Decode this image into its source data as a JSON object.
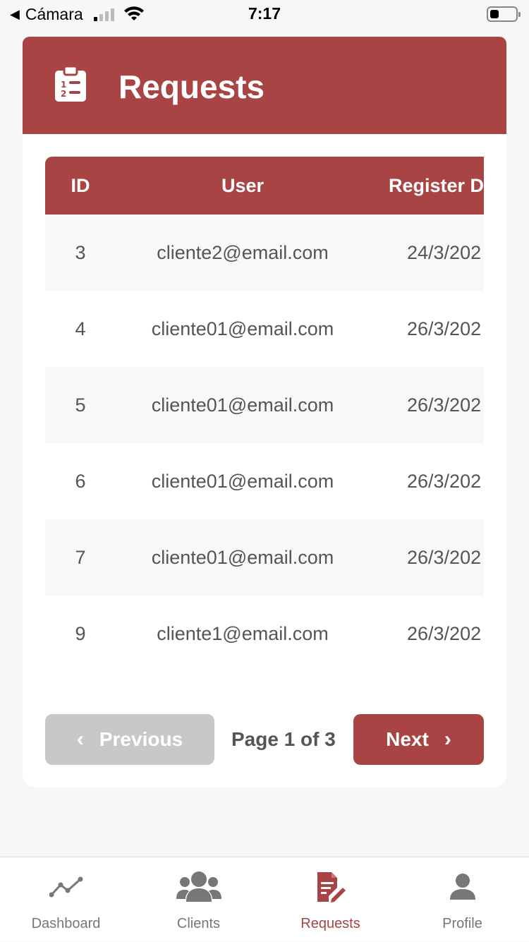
{
  "status_bar": {
    "back_app": "Cámara",
    "time": "7:17"
  },
  "header": {
    "title": "Requests",
    "icon": "clipboard-list-icon"
  },
  "table": {
    "columns": [
      "ID",
      "User",
      "Register D"
    ],
    "rows": [
      {
        "id": "3",
        "user": "cliente2@email.com",
        "date": "24/3/202"
      },
      {
        "id": "4",
        "user": "cliente01@email.com",
        "date": "26/3/202"
      },
      {
        "id": "5",
        "user": "cliente01@email.com",
        "date": "26/3/202"
      },
      {
        "id": "6",
        "user": "cliente01@email.com",
        "date": "26/3/202"
      },
      {
        "id": "7",
        "user": "cliente01@email.com",
        "date": "26/3/202"
      },
      {
        "id": "9",
        "user": "cliente1@email.com",
        "date": "26/3/202"
      }
    ]
  },
  "pagination": {
    "previous_label": "Previous",
    "next_label": "Next",
    "page_info": "Page 1 of 3"
  },
  "tabbar": {
    "tabs": [
      {
        "label": "Dashboard",
        "icon": "chart-line-icon",
        "active": false
      },
      {
        "label": "Clients",
        "icon": "users-icon",
        "active": false
      },
      {
        "label": "Requests",
        "icon": "file-edit-icon",
        "active": true
      },
      {
        "label": "Profile",
        "icon": "user-icon",
        "active": false
      }
    ]
  },
  "colors": {
    "brand": "#a84444",
    "disabled": "#c8c8c8"
  }
}
